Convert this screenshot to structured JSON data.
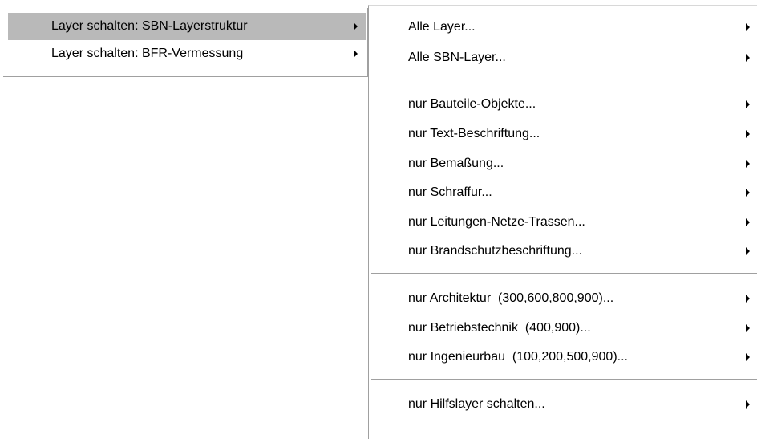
{
  "left_menu": {
    "items": [
      {
        "label": "Layer schalten: SBN-Layerstruktur",
        "highlighted": true
      },
      {
        "label": "Layer schalten: BFR-Vermessung",
        "highlighted": false
      }
    ]
  },
  "right_menu": {
    "group1": [
      {
        "label": "Alle Layer..."
      },
      {
        "label": "Alle SBN-Layer..."
      }
    ],
    "group2": [
      {
        "label": "nur Bauteile-Objekte..."
      },
      {
        "label": "nur Text-Beschriftung..."
      },
      {
        "label": "nur Bemaßung..."
      },
      {
        "label": "nur Schraffur..."
      },
      {
        "label": "nur Leitungen-Netze-Trassen..."
      },
      {
        "label": "nur Brandschutzbeschriftung..."
      }
    ],
    "group3": [
      {
        "label": "nur Architektur  (300,600,800,900)..."
      },
      {
        "label": "nur Betriebstechnik  (400,900)..."
      },
      {
        "label": "nur Ingenieurbau  (100,200,500,900)..."
      }
    ],
    "group4": [
      {
        "label": "nur Hilfslayer schalten..."
      }
    ]
  },
  "icons": {
    "submenu_arrow": "submenu-arrow-icon"
  },
  "colors": {
    "highlight": "#b9b9b9",
    "separator": "#a0a0a0",
    "background": "#ffffff",
    "text": "#000000"
  }
}
